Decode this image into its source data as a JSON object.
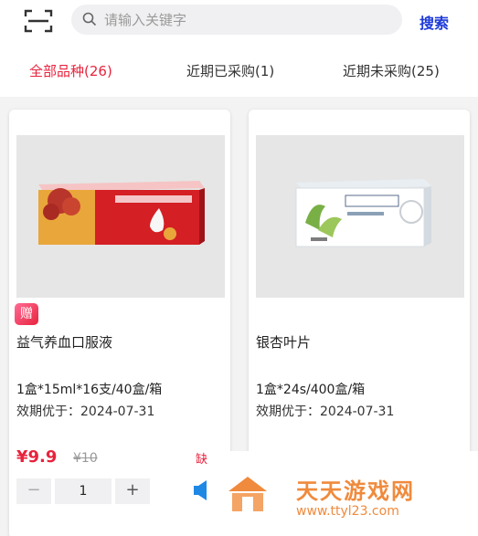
{
  "header": {
    "scan_icon": "scan-icon",
    "search": {
      "placeholder": "请输入关键字",
      "icon": "search-icon"
    },
    "search_button": "搜索"
  },
  "tabs": [
    {
      "label": "全部品种(26)",
      "active": true
    },
    {
      "label": "近期已采购(1)",
      "active": false
    },
    {
      "label": "近期未采购(25)",
      "active": false
    }
  ],
  "products": [
    {
      "gift_badge": "赠",
      "name": "益气养血口服液",
      "spec": "1盒*15ml*16支/40盒/箱",
      "expiry": "效期优于：2024-07-31",
      "price": "¥9.9",
      "original_price": "¥10",
      "stock_tag": "缺",
      "quantity": "1",
      "minus": "−",
      "plus": "+"
    },
    {
      "name": "银杏叶片",
      "spec": "1盒*24s/400盒/箱",
      "expiry": "效期优于：2024-07-31"
    }
  ],
  "watermark": {
    "title": "天天游戏网",
    "url": "www.ttyl23.com"
  },
  "colors": {
    "accent_red": "#e8233d",
    "search_blue": "#1d3ad8",
    "watermark_orange": "#f08a3c"
  }
}
